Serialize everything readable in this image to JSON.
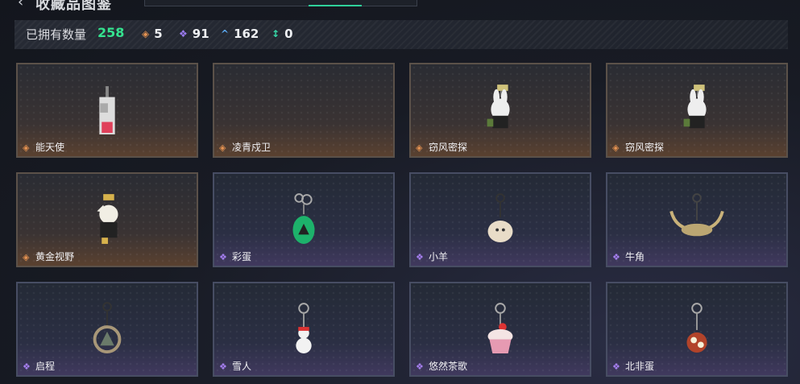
{
  "header": {
    "title": "收藏品图鉴",
    "back_icon": "‹"
  },
  "stats": {
    "owned_label": "已拥有数量",
    "owned_count": "258",
    "counts": [
      {
        "icon": "orange-diamond-icon",
        "glyph": "◈",
        "color": "#e49251",
        "value": "5"
      },
      {
        "icon": "purple-diamond-icon",
        "glyph": "❖",
        "color": "#9c7cf2",
        "value": "91"
      },
      {
        "icon": "blue-chevron-icon",
        "glyph": "^",
        "color": "#5aa7f0",
        "value": "162"
      },
      {
        "icon": "teal-arrows-icon",
        "glyph": "↕",
        "color": "#36d6a6",
        "value": "0"
      }
    ]
  },
  "accent_colors": {
    "active_tab": "#2fd09a",
    "owned_count": "#35e28f"
  },
  "items": [
    {
      "name": "能天使",
      "rarity": "orange"
    },
    {
      "name": "凌青戍卫",
      "rarity": "orange"
    },
    {
      "name": "窃风密探",
      "rarity": "orange"
    },
    {
      "name": "窃风密探",
      "rarity": "orange"
    },
    {
      "name": "黄金视野",
      "rarity": "orange"
    },
    {
      "name": "彩蛋",
      "rarity": "purple"
    },
    {
      "name": "小羊",
      "rarity": "purple"
    },
    {
      "name": "牛角",
      "rarity": "purple"
    },
    {
      "name": "启程",
      "rarity": "purple"
    },
    {
      "name": "雪人",
      "rarity": "purple"
    },
    {
      "name": "悠然茶歌",
      "rarity": "purple"
    },
    {
      "name": "北非蛋",
      "rarity": "purple"
    }
  ]
}
